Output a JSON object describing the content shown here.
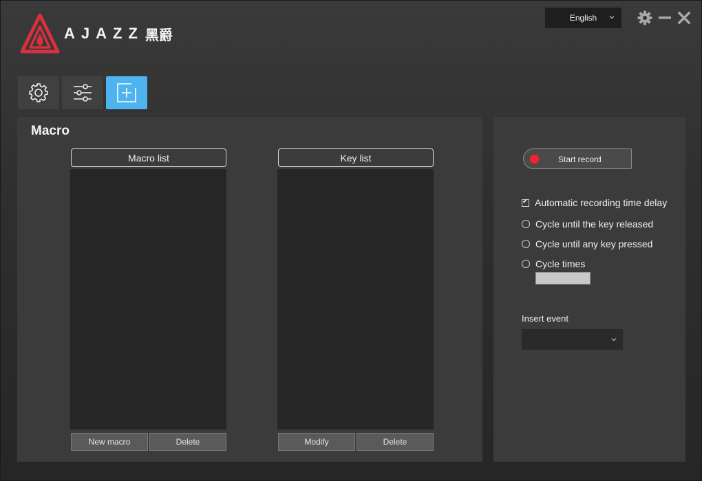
{
  "brand": {
    "name": "AJAZZ",
    "name_cn": "黑爵",
    "accent": "#d6313c"
  },
  "header": {
    "language": "English",
    "icons": [
      "settings-gear-icon",
      "minimize-icon",
      "close-icon"
    ]
  },
  "tabs": [
    {
      "name": "settings-tab",
      "icon": "gear-icon"
    },
    {
      "name": "adjust-tab",
      "icon": "sliders-icon"
    },
    {
      "name": "macro-tab",
      "icon": "add-square-icon",
      "active": true
    }
  ],
  "colors": {
    "active_tab": "#4fb3f0",
    "record_dot": "#ff1e2d"
  },
  "macro": {
    "title": "Macro",
    "macro_list": {
      "header": "Macro list",
      "new_label": "New macro",
      "delete_label": "Delete"
    },
    "key_list": {
      "header": "Key list",
      "modify_label": "Modify",
      "delete_label": "Delete"
    }
  },
  "side": {
    "start_record": "Start record",
    "auto_delay": {
      "label": "Automatic recording time delay",
      "checked": true
    },
    "radios": [
      {
        "label": "Cycle until the key released",
        "selected": false
      },
      {
        "label": "Cycle until any key pressed",
        "selected": false
      },
      {
        "label": "Cycle times",
        "selected": false
      }
    ],
    "cycle_times_value": "",
    "insert_event": {
      "label": "Insert event",
      "value": ""
    }
  }
}
